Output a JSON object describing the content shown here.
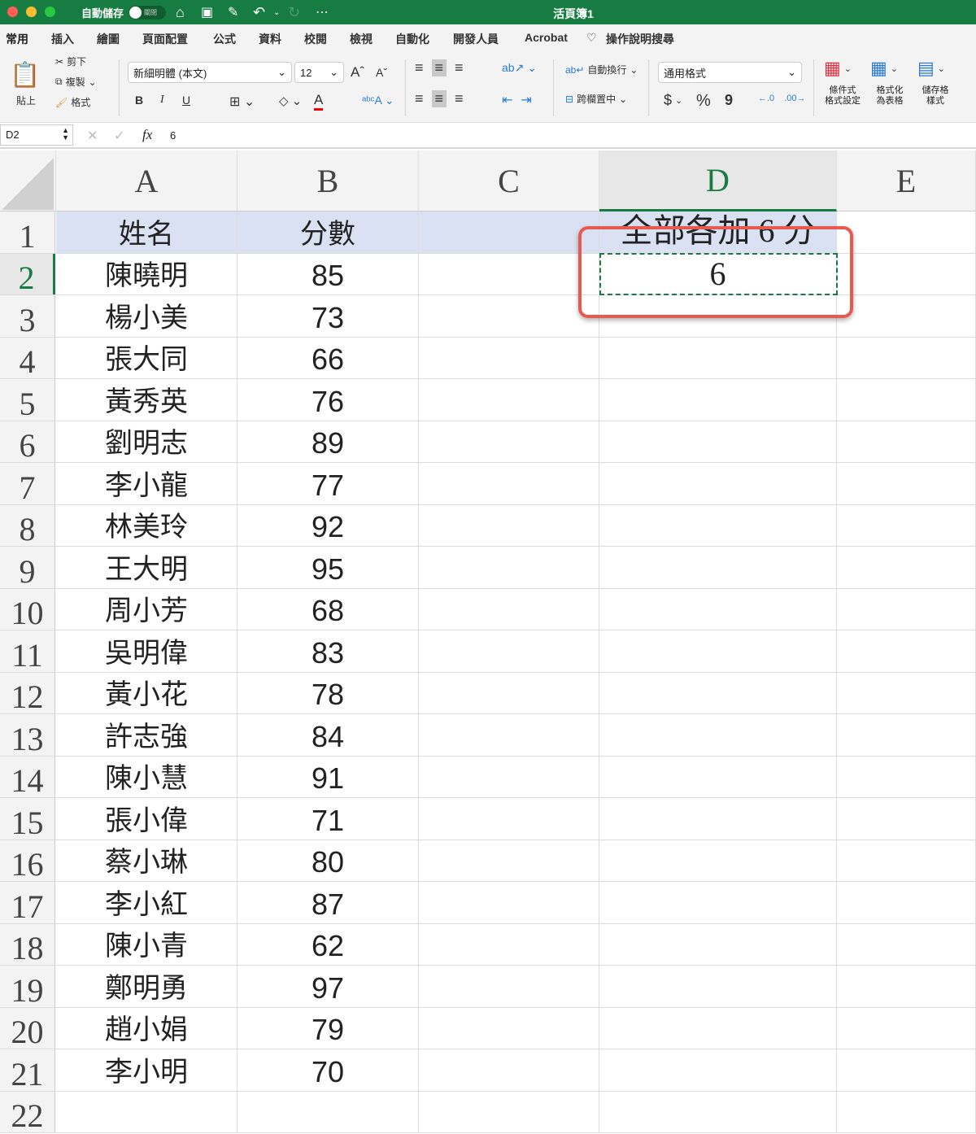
{
  "titlebar": {
    "autosave_label": "自動儲存",
    "autosave_state": "關閉",
    "window_title": "活頁簿1"
  },
  "tabs": [
    "常用",
    "插入",
    "繪圖",
    "頁面配置",
    "公式",
    "資料",
    "校閱",
    "檢視",
    "自動化",
    "開發人員",
    "Acrobat"
  ],
  "help_search": "操作說明搜尋",
  "ribbon": {
    "paste": "貼上",
    "cut": "剪下",
    "copy": "複製",
    "format_painter": "格式",
    "font_name": "新細明體 (本文)",
    "font_size": "12",
    "bold": "B",
    "italic": "I",
    "underline": "U",
    "wrap_text": "自動換行",
    "merge_center": "跨欄置中",
    "number_format": "通用格式",
    "currency": "$",
    "percent": "%",
    "comma": "9",
    "cond_format": [
      "條件式",
      "格式設定"
    ],
    "format_table": [
      "格式化",
      "為表格"
    ],
    "cell_styles": [
      "儲存格",
      "樣式"
    ]
  },
  "formula_bar": {
    "name_box": "D2",
    "fx": "fx",
    "value": "6"
  },
  "columns": [
    "A",
    "B",
    "C",
    "D",
    "E"
  ],
  "sheet": {
    "header": {
      "name": "姓名",
      "score": "分數",
      "d1": "全部各加 6 分"
    },
    "d2": "6",
    "rows": [
      [
        "陳曉明",
        "85"
      ],
      [
        "楊小美",
        "73"
      ],
      [
        "張大同",
        "66"
      ],
      [
        "黃秀英",
        "76"
      ],
      [
        "劉明志",
        "89"
      ],
      [
        "李小龍",
        "77"
      ],
      [
        "林美玲",
        "92"
      ],
      [
        "王大明",
        "95"
      ],
      [
        "周小芳",
        "68"
      ],
      [
        "吳明偉",
        "83"
      ],
      [
        "黃小花",
        "78"
      ],
      [
        "許志強",
        "84"
      ],
      [
        "陳小慧",
        "91"
      ],
      [
        "張小偉",
        "71"
      ],
      [
        "蔡小琳",
        "80"
      ],
      [
        "李小紅",
        "87"
      ],
      [
        "陳小青",
        "62"
      ],
      [
        "鄭明勇",
        "97"
      ],
      [
        "趙小娟",
        "79"
      ],
      [
        "李小明",
        "70"
      ]
    ],
    "row_numbers": [
      "1",
      "2",
      "3",
      "4",
      "5",
      "6",
      "7",
      "8",
      "9",
      "10",
      "11",
      "12",
      "13",
      "14",
      "15",
      "16",
      "17",
      "18",
      "19",
      "20",
      "21",
      "22"
    ]
  },
  "colors": {
    "accent": "#177c42",
    "highlight": "#e65a50",
    "header_fill": "#dae1f2"
  }
}
